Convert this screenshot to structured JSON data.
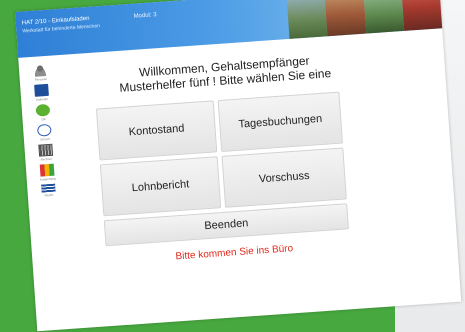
{
  "header": {
    "title": "HAT 2/10 - Einkaufsladen",
    "subtitle": "Werkstatt für behinderte Menschen",
    "center_text": "Modul: 3"
  },
  "sidebar": {
    "items": [
      {
        "label": "Personal",
        "icon": "person-icon"
      },
      {
        "label": "Kalender",
        "icon": "calendar-icon"
      },
      {
        "label": "OK",
        "icon": "check-icon"
      },
      {
        "label": "Uhrzeit",
        "icon": "clock-icon"
      },
      {
        "label": "Rechner",
        "icon": "calculator-icon"
      },
      {
        "label": "Auswertung",
        "icon": "chart-icon"
      },
      {
        "label": "Tabelle",
        "icon": "table-icon"
      }
    ]
  },
  "main": {
    "welcome_line1": "Willkommen, Gehaltsempfänger",
    "welcome_line2": "Musterhelfer fünf ! Bitte wählen Sie eine",
    "buttons": {
      "kontostand": "Kontostand",
      "tagesbuchungen": "Tagesbuchungen",
      "lohnbericht": "Lohnbericht",
      "vorschuss": "Vorschuss",
      "beenden": "Beenden"
    },
    "message": "Bitte kommen Sie ins Büro"
  },
  "colors": {
    "background": "#47a83f",
    "header_start": "#2e7fd6",
    "message": "#e02a1c"
  }
}
